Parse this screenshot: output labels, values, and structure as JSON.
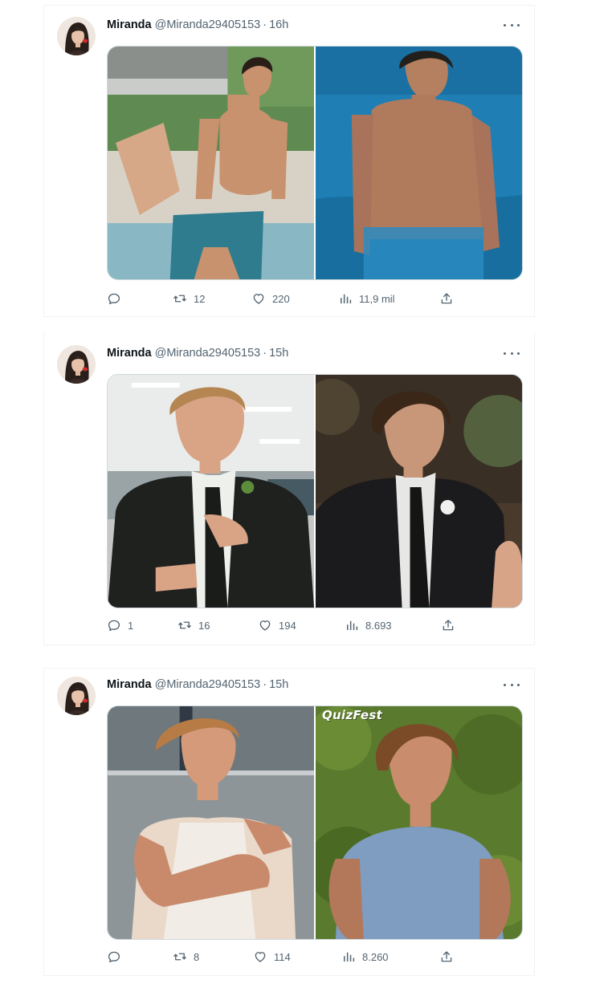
{
  "colors": {
    "text_primary": "#0f1419",
    "text_secondary": "#536471",
    "border": "#eff3f4"
  },
  "tweets": [
    {
      "name": "Miranda",
      "handle": "@Miranda29405153",
      "separator": "·",
      "time": "16h",
      "replies": "",
      "retweets": "12",
      "likes": "220",
      "views": "11,9 mil",
      "watermark": ""
    },
    {
      "name": "Miranda",
      "handle": "@Miranda29405153",
      "separator": "·",
      "time": "15h",
      "replies": "1",
      "retweets": "16",
      "likes": "194",
      "views": "8.693",
      "watermark": ""
    },
    {
      "name": "Miranda",
      "handle": "@Miranda29405153",
      "separator": "·",
      "time": "15h",
      "replies": "",
      "retweets": "8",
      "likes": "114",
      "views": "8.260",
      "watermark": "QuizFest"
    }
  ]
}
